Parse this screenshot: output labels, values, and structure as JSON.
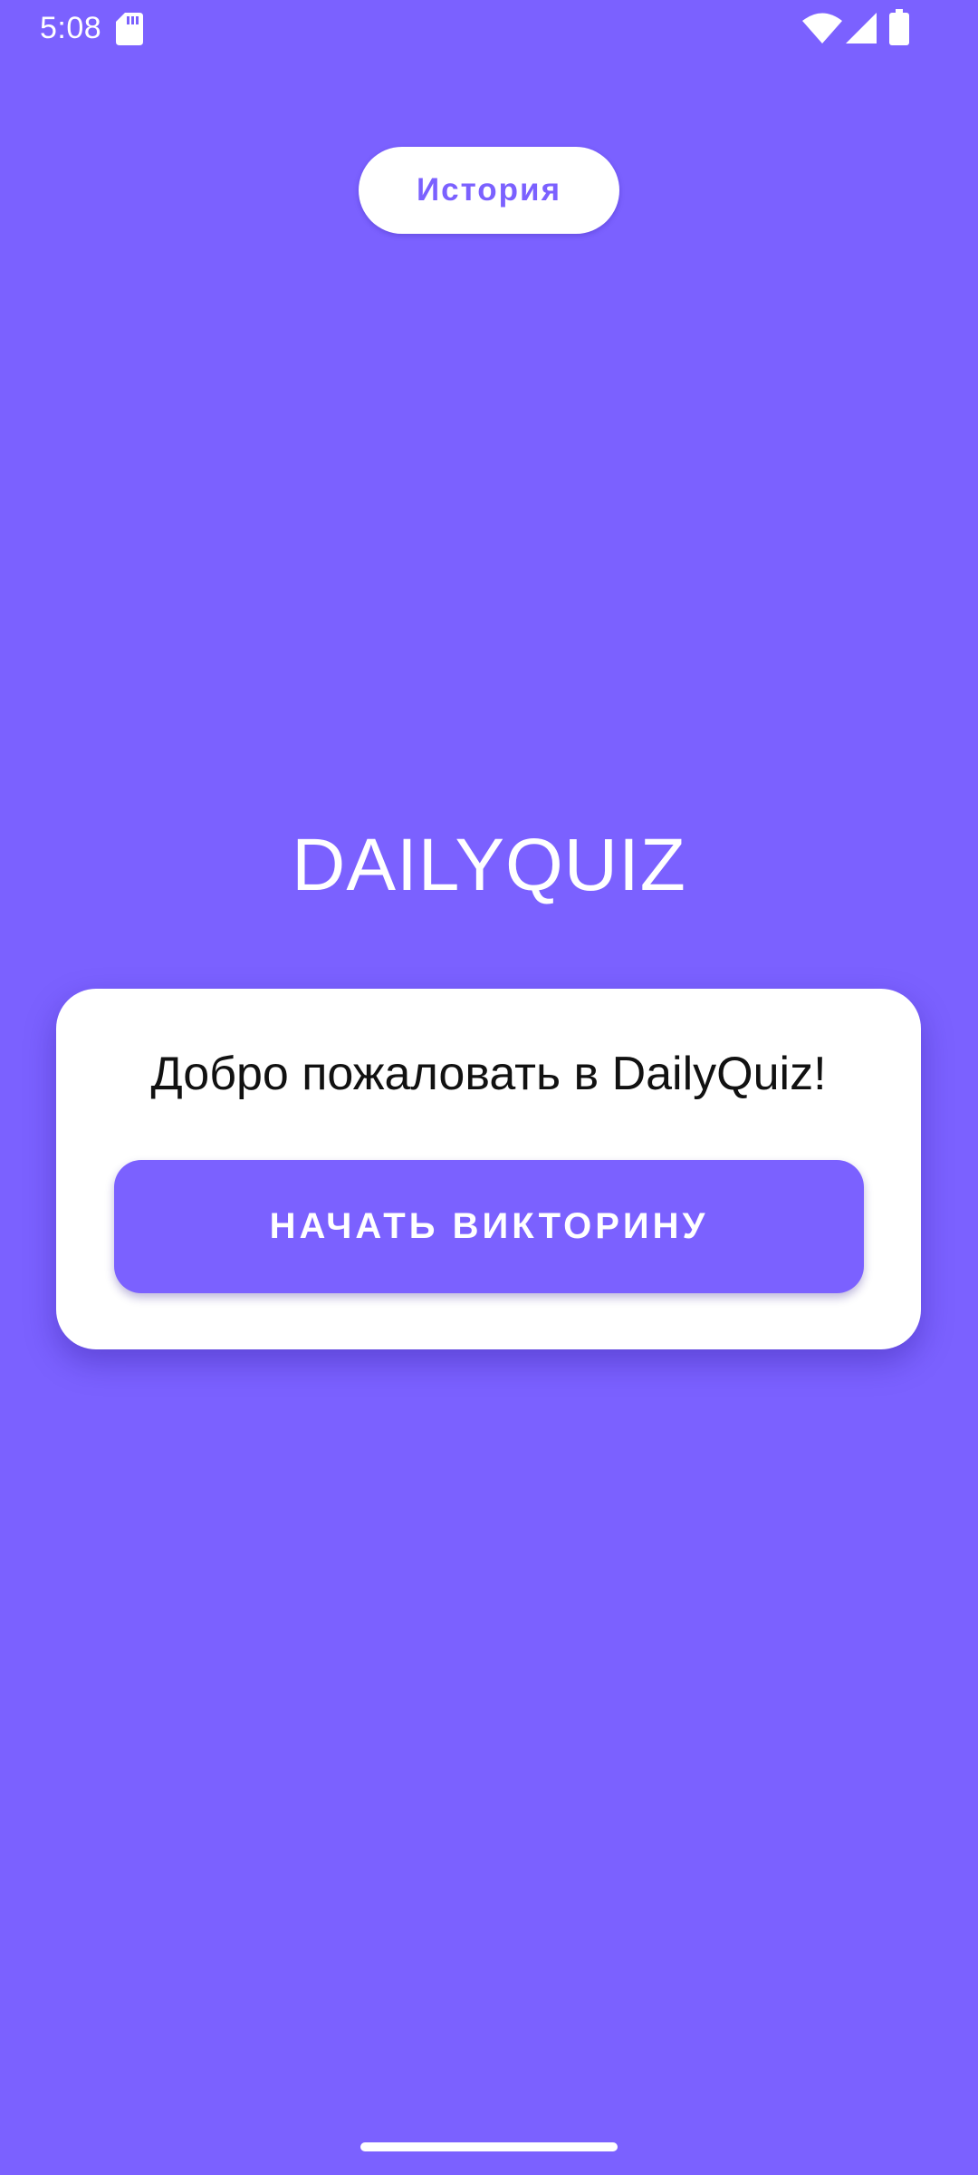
{
  "status_bar": {
    "time": "5:08",
    "icons": [
      "sd-card-icon",
      "wifi-icon",
      "signal-icon",
      "battery-icon"
    ]
  },
  "header": {
    "history_label": "История"
  },
  "main": {
    "title": "DAILYQUIZ",
    "welcome_text": "Добро пожаловать в DailyQuiz!",
    "start_button_label": "НАЧАТЬ ВИКТОРИНУ"
  },
  "colors": {
    "background": "#7B61FF",
    "card": "#FFFFFF",
    "accent": "#7B61FF",
    "text_dark": "#111111"
  }
}
